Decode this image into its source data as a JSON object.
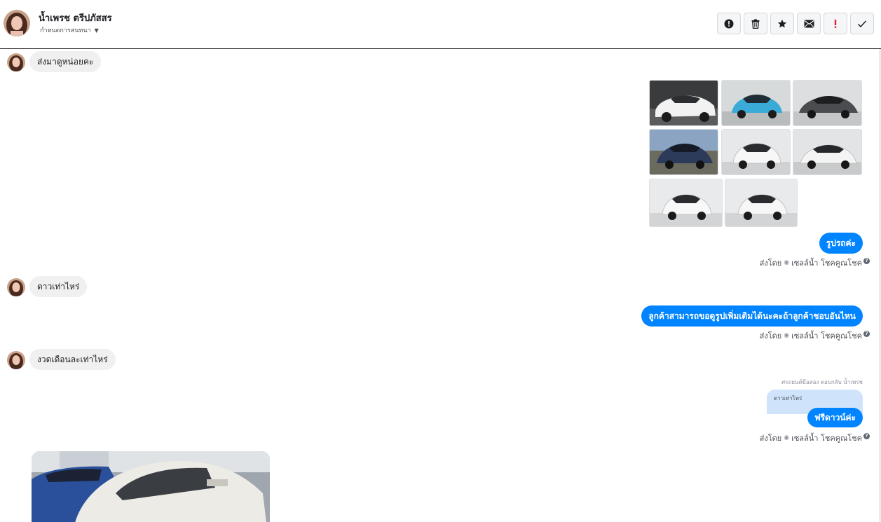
{
  "header": {
    "contact_name": "น้ำเพรช ตรีปภัสสร",
    "assign_label": "กำหนดการสนทนา",
    "actions": [
      {
        "icon": "spam-icon",
        "label": "Mark as spam"
      },
      {
        "icon": "trash-icon",
        "label": "Delete"
      },
      {
        "icon": "star-icon",
        "label": "Star"
      },
      {
        "icon": "envelope-icon",
        "label": "Mark as unread"
      },
      {
        "icon": "exclamation-icon",
        "label": "Follow up"
      },
      {
        "icon": "check-icon",
        "label": "Mark as done"
      }
    ]
  },
  "messages": {
    "in1": "ส่งมาดูหน่อยคะ",
    "out1": "รูปรถค่ะ",
    "in2": "ดาวเท่าไหร่",
    "out2": "ลูกค้าสามารถขอดูรูปเพิ่มเติมได้นะคะถ้าลูกค้าชอบอันไหน",
    "in3": "งวดเดือนละเท่าไหร่",
    "reply_meta": "ศรถยนต์มือสอง ตอบกลับ น้ำเพรช",
    "quote_text": "ดาวเท่าไหร่",
    "out3": "ฟรีดาวน์ค่ะ"
  },
  "sent_by": {
    "prefix": "ส่งโดย",
    "name": "เซลล์น้ำ โชคคูณโชค",
    "help": "?"
  },
  "colors": {
    "outgoing_bubble": "#0084ff",
    "incoming_bubble": "#f1f0f0",
    "quote_bg": "#cfe4fb",
    "alert_red": "#e41e3f"
  }
}
